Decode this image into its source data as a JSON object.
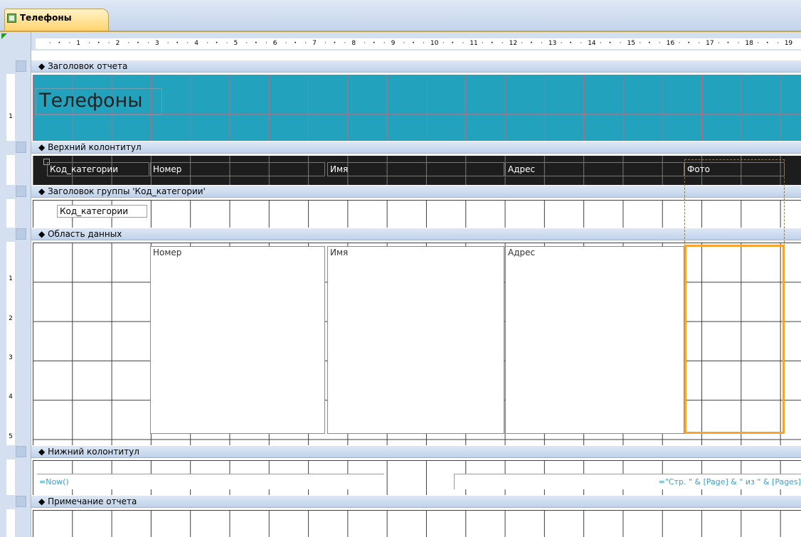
{
  "tab": {
    "label": "Телефоны"
  },
  "ruler": {
    "labels": [
      "1",
      "2",
      "3",
      "4",
      "5",
      "6",
      "7",
      "8",
      "9",
      "10",
      "11",
      "12",
      "13",
      "14",
      "15",
      "16",
      "17",
      "18",
      "19"
    ]
  },
  "vruler": {
    "labels": [
      "1",
      "2",
      "3",
      "4",
      "5"
    ]
  },
  "sections": {
    "report_header": "Заголовок отчета",
    "page_header": "Верхний колонтитул",
    "group_header": "Заголовок группы 'Код_категории'",
    "detail": "Область данных",
    "page_footer": "Нижний колонтитул",
    "report_footer": "Примечание отчета"
  },
  "report_header": {
    "title": "Телефоны"
  },
  "page_header": {
    "columns": [
      "Код_категории",
      "Номер",
      "Имя",
      "Адрес",
      "Фото"
    ]
  },
  "group_header": {
    "field": "Код_категории"
  },
  "detail": {
    "fields": [
      "Номер",
      "Имя",
      "Адрес"
    ]
  },
  "page_footer": {
    "date_formula": "=Now()",
    "page_formula": "=\"Стр. \" & [Page] & \" из \" & [Pages]"
  },
  "colors": {
    "teal_band": "#23a2be",
    "selection": "#f7a334",
    "dark_band": "#1d1d1d"
  }
}
